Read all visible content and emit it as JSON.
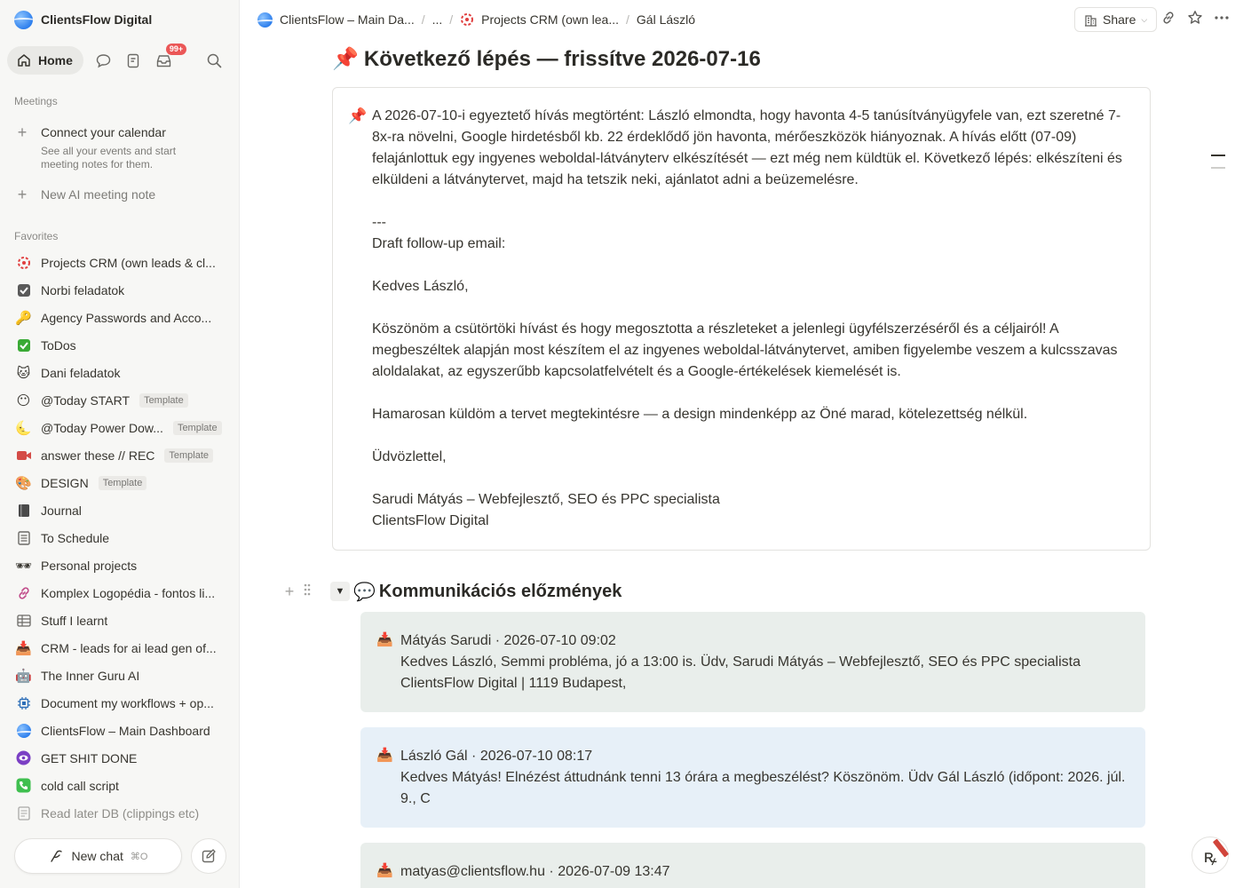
{
  "sidebar": {
    "workspace": "ClientsFlow Digital",
    "home_label": "Home",
    "inbox_badge": "99+",
    "meetings_label": "Meetings",
    "connect_calendar": "Connect your calendar",
    "connect_calendar_desc_1": "See all your events and start",
    "connect_calendar_desc_2": "meeting notes for them.",
    "new_meeting_note": "New AI meeting note",
    "favorites_label": "Favorites",
    "favorites": [
      {
        "label": "Projects CRM (own leads & cl...",
        "icon": "crm-icon",
        "template": ""
      },
      {
        "label": "Norbi feladatok",
        "icon": "checkbox-icon",
        "template": ""
      },
      {
        "label": "Agency Passwords and Acco...",
        "icon": "key-icon",
        "template": ""
      },
      {
        "label": "ToDos",
        "icon": "check-mark-icon",
        "template": ""
      },
      {
        "label": "Dani feladatok",
        "icon": "cat-icon",
        "template": ""
      },
      {
        "label": "@Today START",
        "icon": "smiley-icon",
        "template": "Template"
      },
      {
        "label": "@Today Power Dow...",
        "icon": "moon-icon",
        "template": "Template"
      },
      {
        "label": "answer these // REC",
        "icon": "video-camera-icon",
        "template": "Template"
      },
      {
        "label": "DESIGN",
        "icon": "palette-icon",
        "template": "Template"
      },
      {
        "label": "Journal",
        "icon": "notebook-icon",
        "template": ""
      },
      {
        "label": "To Schedule",
        "icon": "ledger-icon",
        "template": ""
      },
      {
        "label": "Personal projects",
        "icon": "sunglasses-icon",
        "template": ""
      },
      {
        "label": "Komplex Logopédia - fontos li...",
        "icon": "link-icon",
        "template": ""
      },
      {
        "label": "Stuff I learnt",
        "icon": "table-icon",
        "template": ""
      },
      {
        "label": "CRM - leads for ai lead gen of...",
        "icon": "inbox-tray-icon",
        "template": ""
      },
      {
        "label": "The Inner Guru AI",
        "icon": "robot-icon",
        "template": ""
      },
      {
        "label": "Document my workflows + op...",
        "icon": "chip-icon",
        "template": ""
      },
      {
        "label": "ClientsFlow – Main Dashboard",
        "icon": "globe-icon",
        "template": ""
      },
      {
        "label": "GET SHIT DONE",
        "icon": "purple-eye-icon",
        "template": ""
      },
      {
        "label": "cold call script",
        "icon": "phone-icon",
        "template": ""
      },
      {
        "label": "Read later DB (clippings etc)",
        "icon": "page-icon",
        "template": ""
      }
    ],
    "new_chat": "New chat",
    "new_chat_shortcut": "⌘O"
  },
  "breadcrumb": {
    "item1": "ClientsFlow – Main Da...",
    "ellipsis": "...",
    "item2": "Projects CRM (own lea...",
    "item3": "Gál László",
    "share": "Share"
  },
  "page": {
    "title": "Következő lépés — frissítve 2026-07-16",
    "callout_lines": [
      "A 2026-07-10-i egyeztető hívás megtörtént: László elmondta, hogy havonta 4-5 tanúsítványügyfele van, ezt szeretné 7-8x-ra növelni, Google hirdetésből kb. 22 érdeklődő jön havonta, mérőeszközök hiányoznak. A hívás előtt (07-09) felajánlottuk egy ingyenes weboldal-látványterv elkészítését — ezt még nem küldtük el. Következő lépés: elkészíteni és elküldeni a látványtervet, majd ha tetszik neki, ajánlatot adni a beüzemelésre.",
      "",
      "---",
      "Draft follow-up email:",
      "",
      "Kedves László,",
      "",
      "Köszönöm a csütörtöki hívást és hogy megosztotta a részleteket a jelenlegi ügyfélszerzéséről és a céljairól! A megbeszéltek alapján most készítem el az ingyenes weboldal-látványtervet, amiben figyelembe veszem a kulcsszavas aloldalakat, az egyszerűbb kapcsolatfelvételt és a Google-értékelések kiemelését is.",
      "",
      "Hamarosan küldöm a tervet megtekintésre — a design mindenképp az Öné marad, kötelezettség nélkül.",
      "",
      "Üdvözlettel,",
      "",
      "Sarudi Mátyás – Webfejlesztő, SEO és PPC specialista",
      "ClientsFlow Digital"
    ],
    "section_heading": "Kommunikációs előzmények",
    "messages": [
      {
        "header": "Mátyás Sarudi · 2026-07-10 09:02",
        "body": "Kedves László, Semmi probléma, jó a 13:00 is. Üdv, Sarudi Mátyás – Webfejlesztő, SEO és PPC specialista ClientsFlow Digital | 1119 Budapest,"
      },
      {
        "header": "László Gál · 2026-07-10 08:17",
        "body": "Kedves Mátyás! Elnézést áttudnánk tenni 13 órára a megbeszélést? Köszönöm. Üdv Gál László (időpont: 2026. júl. 9., C"
      },
      {
        "header": "matyas@clientsflow.hu · 2026-07-09 13:47",
        "body": ""
      }
    ]
  }
}
